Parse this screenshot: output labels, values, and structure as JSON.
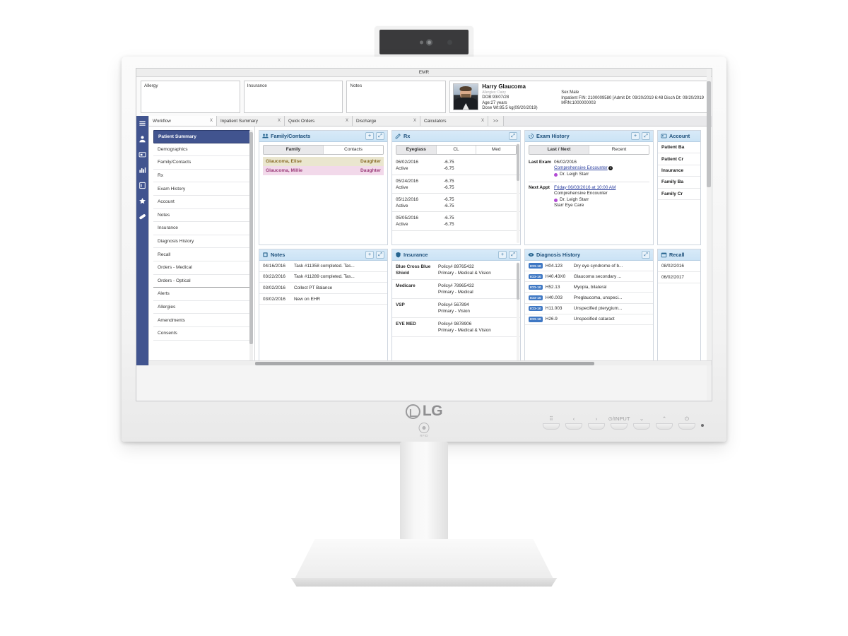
{
  "hardware": {
    "brand": "LG",
    "rfid_label": "RFID",
    "osd_buttons": [
      {
        "name": "menu-grid-button",
        "glyph": "⠿"
      },
      {
        "name": "left-button",
        "glyph": "‹"
      },
      {
        "name": "right-button",
        "glyph": "›"
      },
      {
        "name": "input-button",
        "glyph": "⊙/INPUT"
      },
      {
        "name": "down-button",
        "glyph": "⌄"
      },
      {
        "name": "up-button",
        "glyph": "⌃"
      },
      {
        "name": "power-button",
        "glyph": "⏻"
      }
    ]
  },
  "app": {
    "title": "EMR",
    "banner": {
      "allergy_label": "Allergy",
      "insurance_label": "Insurance",
      "notes_label": "Notes"
    },
    "patient": {
      "name": "Harry Glaucoma",
      "allergies": "Allergies: Dairy",
      "dob": "DOB:93/07/28",
      "age": "Age:27 years",
      "dose_weight": "Dose Wt:85.5 kg(09/20/2019)",
      "sex": "Sex:Male",
      "inpatient": "Inpatient FIN: 2100009580 [Admit Dt: 09/20/2019 6:48 Disch Dt: 09/20/2019",
      "mrn": "MRN:1000000003"
    },
    "tabs": [
      {
        "label": "Workflow",
        "close": "X",
        "active": true
      },
      {
        "label": "Inpatient Summary",
        "close": "X",
        "active": false
      },
      {
        "label": "Quick Orders",
        "close": "X",
        "active": false
      },
      {
        "label": "Discharge",
        "close": "X",
        "active": false
      },
      {
        "label": "Calculators",
        "close": "X",
        "active": false
      },
      {
        "label": ">>",
        "close": "",
        "active": false
      }
    ],
    "icon_rail": [
      {
        "name": "hamburger-menu-icon"
      },
      {
        "name": "patient-icon"
      },
      {
        "name": "card-icon"
      },
      {
        "name": "chart-icon"
      },
      {
        "name": "document-icon"
      },
      {
        "name": "star-icon"
      },
      {
        "name": "pill-icon"
      }
    ],
    "nav_items": [
      {
        "label": "Patient Summary",
        "active": true
      },
      {
        "label": "Demographics",
        "active": false
      },
      {
        "label": "Family/Contacts",
        "active": false
      },
      {
        "label": "Rx",
        "active": false
      },
      {
        "label": "Exam History",
        "active": false
      },
      {
        "label": "Account",
        "active": false
      },
      {
        "label": "Notes",
        "active": false
      },
      {
        "label": "Insurance",
        "active": false
      },
      {
        "label": "Diagnosis History",
        "active": false
      },
      {
        "label": "Recall",
        "active": false
      },
      {
        "label": "Orders - Medical",
        "active": false
      },
      {
        "label": "Orders - Optical",
        "active": false,
        "separator": true
      },
      {
        "label": "Alerts",
        "active": false
      },
      {
        "label": "Allergies",
        "active": false
      },
      {
        "label": "Amendments",
        "active": false
      },
      {
        "label": "Consents",
        "active": false
      }
    ],
    "cards": {
      "family": {
        "title": "Family/Contacts",
        "add_label": "+",
        "expand_label": "⤢",
        "tabs": [
          {
            "label": "Family",
            "on": true
          },
          {
            "label": "Contacts",
            "on": false
          }
        ],
        "rows": [
          {
            "name": "Glaucoma, Elise",
            "relation": "Daughter",
            "color": "yellow"
          },
          {
            "name": "Glaucoma, Millie",
            "relation": "Daughter",
            "color": "pink"
          }
        ]
      },
      "rx": {
        "title": "Rx",
        "expand_label": "⤢",
        "tabs": [
          {
            "label": "Eyeglass",
            "on": true
          },
          {
            "label": "CL",
            "on": false
          },
          {
            "label": "Med",
            "on": false
          }
        ],
        "rows": [
          {
            "date": "06/02/2016",
            "status": "Active",
            "od": "-6.75",
            "os": "-6.75"
          },
          {
            "date": "05/24/2016",
            "status": "Active",
            "od": "-6.75",
            "os": "-6.75"
          },
          {
            "date": "05/12/2016",
            "status": "Active",
            "od": "-6.75",
            "os": "-6.75"
          },
          {
            "date": "05/05/2016",
            "status": "Active",
            "od": "-6.75",
            "os": "-6.75"
          }
        ]
      },
      "exam": {
        "title": "Exam History",
        "add_label": "+",
        "expand_label": "⤢",
        "tabs": [
          {
            "label": "Last / Next",
            "on": true
          },
          {
            "label": "Recent",
            "on": false
          }
        ],
        "last_label": "Last Exam",
        "last_date": "06/02/2016",
        "last_type": "Comprehensive Encounter",
        "last_doctor": "Dr. Leigh Starr",
        "next_label": "Next Appt",
        "next_date": "Friday 06/03/2016 at 10:00 AM",
        "next_type": "Comprehensive Encounter",
        "next_doctor": "Dr. Leigh Starr",
        "next_location": "Starr Eye Care"
      },
      "account": {
        "title": "Account",
        "rows": [
          "Patient Ba",
          "Patient Cr",
          "Insurance",
          "Family Ba",
          "Family Cr"
        ]
      },
      "notes": {
        "title": "Notes",
        "add_label": "+",
        "expand_label": "⤢",
        "rows": [
          {
            "date": "04/16/2016",
            "text": "Task #11358 completed. Tas..."
          },
          {
            "date": "03/22/2016",
            "text": "Task #11289 completed. Tas..."
          },
          {
            "date": "03/02/2016",
            "text": "Collect PT Balance"
          },
          {
            "date": "03/02/2016",
            "text": "New on EHR"
          }
        ]
      },
      "insurance": {
        "title": "Insurance",
        "add_label": "+",
        "expand_label": "⤢",
        "rows": [
          {
            "name": "Blue Cross Blue Shield",
            "policy": "Policy# 89765432",
            "plan": "Primary - Medical & Vision"
          },
          {
            "name": "Medicare",
            "policy": "Policy# 78965432",
            "plan": "Primary - Medical"
          },
          {
            "name": "VSP",
            "policy": "Policy# 567894",
            "plan": "Primary - Vision"
          },
          {
            "name": "EYE MED",
            "policy": "Policy# 9878906",
            "plan": "Primary - Medical & Vision"
          }
        ]
      },
      "diagnosis": {
        "title": "Diagnosis History",
        "expand_label": "⤢",
        "badge": "ICD-10",
        "rows": [
          {
            "code": "H04.123",
            "desc": "Dry eye syndrome of b..."
          },
          {
            "code": "H40.43X0",
            "desc": "Glaucoma secondary ..."
          },
          {
            "code": "H52.13",
            "desc": "Myopia, bilateral"
          },
          {
            "code": "H40.003",
            "desc": "Preglaucoma, unspeci..."
          },
          {
            "code": "H11.003",
            "desc": "Unspecified pterygium..."
          },
          {
            "code": "H26.9",
            "desc": "Unspecified cataract"
          }
        ]
      },
      "recall": {
        "title": "Recall",
        "rows": [
          "08/02/2016",
          "06/02/2017"
        ]
      }
    }
  },
  "colors": {
    "nav_blue": "#41548f",
    "card_header": "#cbe3f5",
    "card_title": "#1d4f7a",
    "icd_badge": "#3f78c4",
    "link": "#2b3fa0",
    "doctor_dot": "#b24bd4"
  }
}
